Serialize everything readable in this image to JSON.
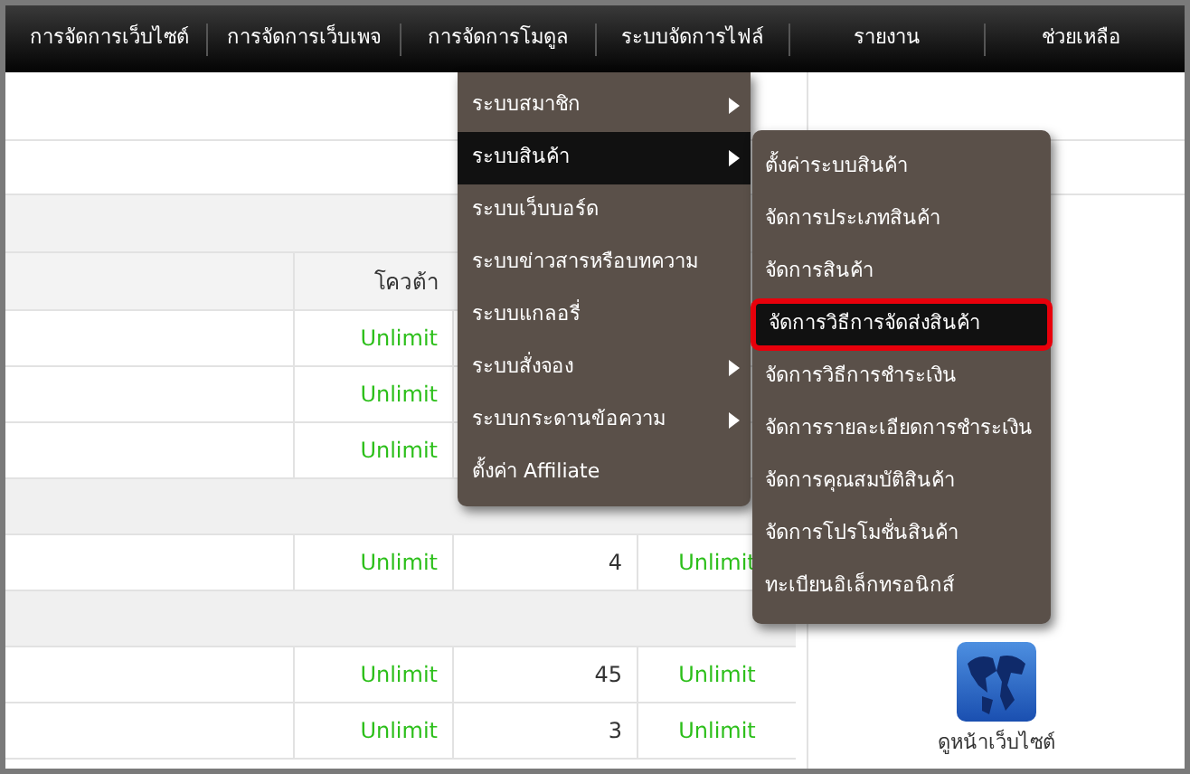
{
  "nav": [
    {
      "label": "การจัดการเว็บไซต์"
    },
    {
      "label": "การจัดการเว็บเพจ"
    },
    {
      "label": "การจัดการโมดูล"
    },
    {
      "label": "ระบบจัดการไฟล์"
    },
    {
      "label": "รายงาน"
    },
    {
      "label": "ช่วยเหลือ"
    }
  ],
  "menu": {
    "items": [
      {
        "label": "ระบบสมาชิก",
        "selected": false,
        "has_submenu": true
      },
      {
        "label": "ระบบสินค้า",
        "selected": true,
        "has_submenu": true
      },
      {
        "label": "ระบบเว็บบอร์ด",
        "selected": false,
        "has_submenu": false
      },
      {
        "label": "ระบบข่าวสารหรือบทความ",
        "selected": false,
        "has_submenu": false
      },
      {
        "label": "ระบบแกลอรี่",
        "selected": false,
        "has_submenu": false
      },
      {
        "label": "ระบบสั่งจอง",
        "selected": false,
        "has_submenu": true
      },
      {
        "label": "ระบบกระดานข้อความ",
        "selected": false,
        "has_submenu": true
      },
      {
        "label": "ตั้งค่า Affiliate",
        "selected": false,
        "has_submenu": false
      }
    ]
  },
  "submenu": {
    "items": [
      {
        "label": "ตั้งค่าระบบสินค้า",
        "selected": false
      },
      {
        "label": "จัดการประเภทสินค้า",
        "selected": false
      },
      {
        "label": "จัดการสินค้า",
        "selected": false
      },
      {
        "label": "จัดการวิธีการจัดส่งสินค้า",
        "selected": true
      },
      {
        "label": "จัดการวิธีการชำระเงิน",
        "selected": false
      },
      {
        "label": "จัดการรายละเอียดการชำระเงิน",
        "selected": false
      },
      {
        "label": "จัดการคุณสมบัติสินค้า",
        "selected": false
      },
      {
        "label": "จัดการโปรโมชั่นสินค้า",
        "selected": false
      },
      {
        "label": "ทะเบียนอิเล็กทรอนิกส์",
        "selected": false
      }
    ]
  },
  "table": {
    "columns": [
      "โควต้า"
    ],
    "rows": [
      {
        "kind": "row",
        "quota": "Unlimit"
      },
      {
        "kind": "row",
        "quota": "Unlimit"
      },
      {
        "kind": "row",
        "quota": "Unlimit"
      },
      {
        "kind": "section"
      },
      {
        "kind": "row",
        "quota": "Unlimit",
        "used": "4",
        "remaining": "Unlimit"
      },
      {
        "kind": "section"
      },
      {
        "kind": "row",
        "quota": "Unlimit",
        "used": "45",
        "remaining": "Unlimit"
      },
      {
        "kind": "row",
        "quota": "Unlimit",
        "used": "3",
        "remaining": "Unlimit"
      }
    ]
  },
  "shortcut": {
    "label": "ดูหน้าเว็บไซต์"
  }
}
